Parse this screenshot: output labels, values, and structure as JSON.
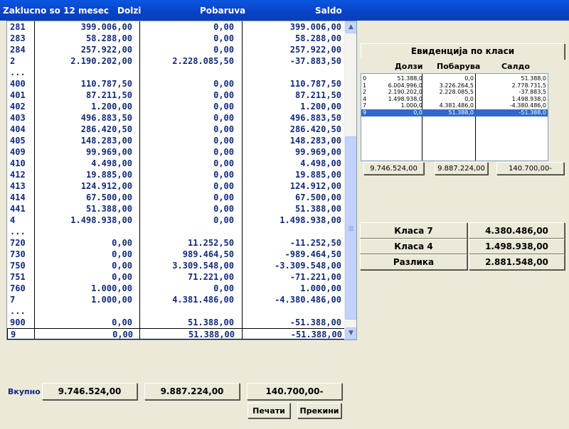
{
  "header": {
    "title": "Zaklucno so 12 mesec",
    "col_dolzi": "Dolzi",
    "col_pobaruva": "Pobaruva",
    "col_saldo": "Saldo"
  },
  "ledger": {
    "rows": [
      {
        "acct": "281",
        "dolzi": "399.006,00",
        "pobaruva": "0,00",
        "saldo": "399.006,00"
      },
      {
        "acct": "283",
        "dolzi": "58.288,00",
        "pobaruva": "0,00",
        "saldo": "58.288,00"
      },
      {
        "acct": "284",
        "dolzi": "257.922,00",
        "pobaruva": "0,00",
        "saldo": "257.922,00"
      },
      {
        "acct": "2",
        "dolzi": "2.190.202,00",
        "pobaruva": "2.228.085,50",
        "saldo": "-37.883,50"
      },
      {
        "acct": "...",
        "dolzi": "",
        "pobaruva": "",
        "saldo": ""
      },
      {
        "acct": "400",
        "dolzi": "110.787,50",
        "pobaruva": "0,00",
        "saldo": "110.787,50"
      },
      {
        "acct": "401",
        "dolzi": "87.211,50",
        "pobaruva": "0,00",
        "saldo": "87.211,50"
      },
      {
        "acct": "402",
        "dolzi": "1.200,00",
        "pobaruva": "0,00",
        "saldo": "1.200,00"
      },
      {
        "acct": "403",
        "dolzi": "496.883,50",
        "pobaruva": "0,00",
        "saldo": "496.883,50"
      },
      {
        "acct": "404",
        "dolzi": "286.420,50",
        "pobaruva": "0,00",
        "saldo": "286.420,50"
      },
      {
        "acct": "405",
        "dolzi": "148.283,00",
        "pobaruva": "0,00",
        "saldo": "148.283,00"
      },
      {
        "acct": "409",
        "dolzi": "99.969,00",
        "pobaruva": "0,00",
        "saldo": "99.969,00"
      },
      {
        "acct": "410",
        "dolzi": "4.498,00",
        "pobaruva": "0,00",
        "saldo": "4.498,00"
      },
      {
        "acct": "412",
        "dolzi": "19.885,00",
        "pobaruva": "0,00",
        "saldo": "19.885,00"
      },
      {
        "acct": "413",
        "dolzi": "124.912,00",
        "pobaruva": "0,00",
        "saldo": "124.912,00"
      },
      {
        "acct": "414",
        "dolzi": "67.500,00",
        "pobaruva": "0,00",
        "saldo": "67.500,00"
      },
      {
        "acct": "441",
        "dolzi": "51.388,00",
        "pobaruva": "0,00",
        "saldo": "51.388,00"
      },
      {
        "acct": "4",
        "dolzi": "1.498.938,00",
        "pobaruva": "0,00",
        "saldo": "1.498.938,00"
      },
      {
        "acct": "...",
        "dolzi": "",
        "pobaruva": "",
        "saldo": ""
      },
      {
        "acct": "720",
        "dolzi": "0,00",
        "pobaruva": "11.252,50",
        "saldo": "-11.252,50"
      },
      {
        "acct": "730",
        "dolzi": "0,00",
        "pobaruva": "989.464,50",
        "saldo": "-989.464,50"
      },
      {
        "acct": "750",
        "dolzi": "0,00",
        "pobaruva": "3.309.548,00",
        "saldo": "-3.309.548,00"
      },
      {
        "acct": "751",
        "dolzi": "0,00",
        "pobaruva": "71.221,00",
        "saldo": "-71.221,00"
      },
      {
        "acct": "760",
        "dolzi": "1.000,00",
        "pobaruva": "0,00",
        "saldo": "1.000,00"
      },
      {
        "acct": "7",
        "dolzi": "1.000,00",
        "pobaruva": "4.381.486,00",
        "saldo": "-4.380.486,00"
      },
      {
        "acct": "...",
        "dolzi": "",
        "pobaruva": "",
        "saldo": ""
      },
      {
        "acct": "900",
        "dolzi": "0,00",
        "pobaruva": "51.388,00",
        "saldo": "-51.388,00"
      },
      {
        "acct": "9",
        "dolzi": "0,00",
        "pobaruva": "51.388,00",
        "saldo": "-51.388,00"
      }
    ],
    "selected_row_index": 27,
    "scroll_up_icon": "chevron-up-icon",
    "scroll_down_icon": "chevron-down-icon"
  },
  "class_panel": {
    "title": "Евиденција по класи",
    "col_dolzi": "Долзи",
    "col_pobaruva": "Побарува",
    "col_saldo": "Салдо",
    "rows": [
      {
        "acct": "0",
        "dolzi": "51.388,0",
        "pobaruva": "0,0",
        "saldo": "51.388,0"
      },
      {
        "acct": "1",
        "dolzi": "6.004.996,0",
        "pobaruva": "3.226.264,5",
        "saldo": "2.778.731,5"
      },
      {
        "acct": "2",
        "dolzi": "2.190.202,0",
        "pobaruva": "2.228.085,5",
        "saldo": "-37.883,5"
      },
      {
        "acct": "4",
        "dolzi": "1.498.938,0",
        "pobaruva": "0,0",
        "saldo": "1.498.938,0"
      },
      {
        "acct": "7",
        "dolzi": "1.000,0",
        "pobaruva": "4.381.486,0",
        "saldo": "-4.380.486,0"
      },
      {
        "acct": "9",
        "dolzi": "0,0",
        "pobaruva": "51.388,0",
        "saldo": "-51.388,0"
      }
    ],
    "selected_row_index": 5,
    "total_dolzi": "9.746.524,00",
    "total_pobaruva": "9.887.224,00",
    "total_saldo": "140.700,00-"
  },
  "class_summary": {
    "klasa7_label": "Класа 7",
    "klasa7_value": "4.380.486,00",
    "klasa4_label": "Класа 4",
    "klasa4_value": "1.498.938,00",
    "razlika_label": "Разлика",
    "razlika_value": "2.881.548,00"
  },
  "footer": {
    "total_label": "Вкупно",
    "total_dolzi": "9.746.524,00",
    "total_pobaruva": "9.887.224,00",
    "total_saldo": "140.700,00-",
    "print_button": "Печати",
    "cancel_button": "Прекини"
  },
  "colors": {
    "title_bar": "#0842c4",
    "ledger_text": "#102a7a",
    "selection": "#316ac5",
    "window_bg": "#ece9d8"
  }
}
